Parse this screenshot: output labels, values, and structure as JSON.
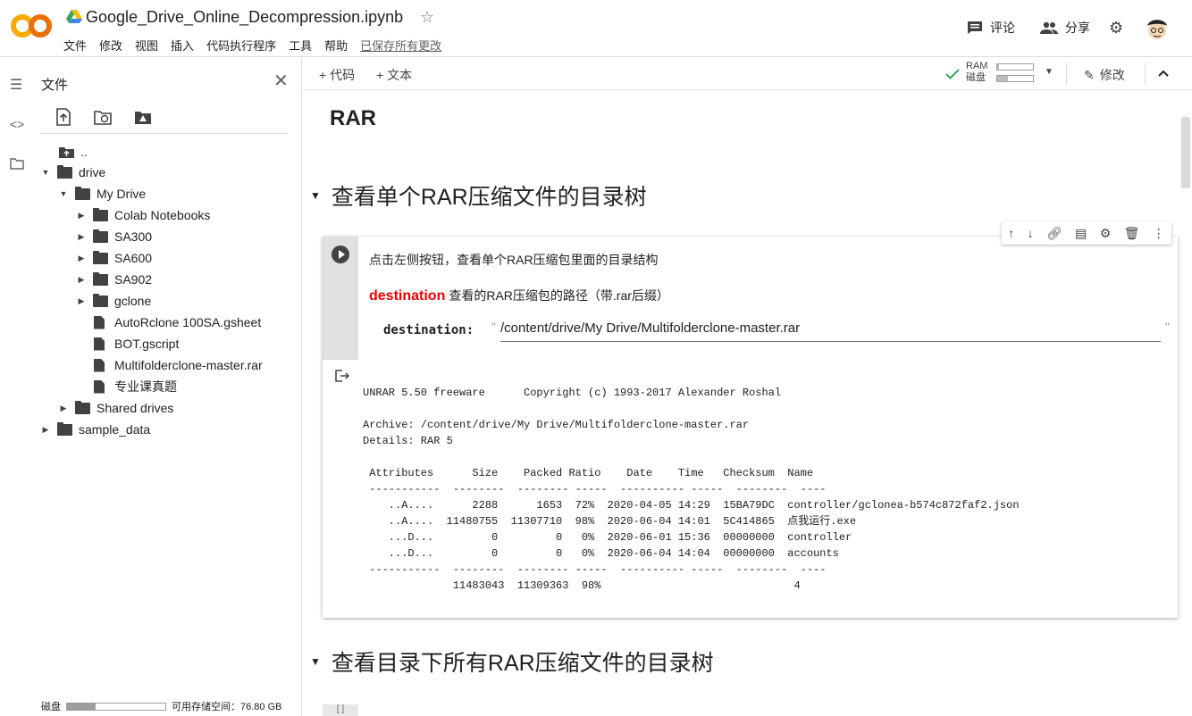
{
  "header": {
    "notebook_title": "Google_Drive_Online_Decompression.ipynb",
    "menu": [
      "文件",
      "修改",
      "视图",
      "插入",
      "代码执行程序",
      "工具",
      "帮助"
    ],
    "saved_status": "已保存所有更改",
    "comment_label": "评论",
    "share_label": "分享"
  },
  "files": {
    "title": "文件",
    "tree": [
      {
        "label": "..",
        "type": "up"
      },
      {
        "label": "drive",
        "type": "folder",
        "expanded": true
      },
      {
        "label": "My Drive",
        "type": "folder",
        "expanded": true
      },
      {
        "label": "Colab Notebooks",
        "type": "folder"
      },
      {
        "label": "SA300",
        "type": "folder"
      },
      {
        "label": "SA600",
        "type": "folder"
      },
      {
        "label": "SA902",
        "type": "folder"
      },
      {
        "label": "gclone",
        "type": "folder"
      },
      {
        "label": "AutoRclone 100SA.gsheet",
        "type": "file"
      },
      {
        "label": "BOT.gscript",
        "type": "file"
      },
      {
        "label": "Multifolderclone-master.rar",
        "type": "file"
      },
      {
        "label": "专业课真题",
        "type": "file"
      },
      {
        "label": "Shared drives",
        "type": "folder"
      },
      {
        "label": "sample_data",
        "type": "folder"
      }
    ],
    "storage_label": "磁盘",
    "storage_used_fraction": 0.29,
    "storage_free": "可用存储空间：76.80 GB"
  },
  "toolbar": {
    "add_code": "+ 代码",
    "add_text": "+ 文本",
    "ram_label": "RAM",
    "disk_label": "磁盘",
    "ram_fraction": 0.05,
    "disk_fraction": 0.3,
    "edit_label": "修改"
  },
  "notebook": {
    "h1": "RAR",
    "section1": "查看单个RAR压缩文件的目录树",
    "cell": {
      "description": "点击左侧按钮，查看单个RAR压缩包里面的目录结构",
      "dest_keyword": "destination",
      "dest_desc": "查看的RAR压缩包的路径（带.rar后缀）",
      "param_label": "destination:",
      "param_value": "/content/drive/My Drive/Multifolderclone-master.rar",
      "output": {
        "line1": "UNRAR 5.50 freeware      Copyright (c) 1993-2017 Alexander Roshal",
        "line2": "Archive: /content/drive/My Drive/Multifolderclone-master.rar",
        "line3": "Details: RAR 5",
        "header": " Attributes      Size    Packed Ratio    Date    Time   Checksum  Name",
        "sep": " -----------  --------  -------- -----  ---------- -----  --------  ----",
        "rows": [
          "    ..A....      2288      1653  72%  2020-04-05 14:29  15BA79DC  controller/gclonea-b574c872faf2.json",
          "    ..A....  11480755  11307710  98%  2020-06-04 14:01  5C414865  点我运行.exe",
          "    ...D...         0         0   0%  2020-06-01 15:36  00000000  controller",
          "    ...D...         0         0   0%  2020-06-04 14:04  00000000  accounts"
        ],
        "sep2": " -----------  --------  -------- -----  ---------- -----  --------  ----",
        "total": "              11483043  11309363  98%                              4"
      }
    },
    "section2": "查看目录下所有RAR压缩文件的目录树"
  }
}
